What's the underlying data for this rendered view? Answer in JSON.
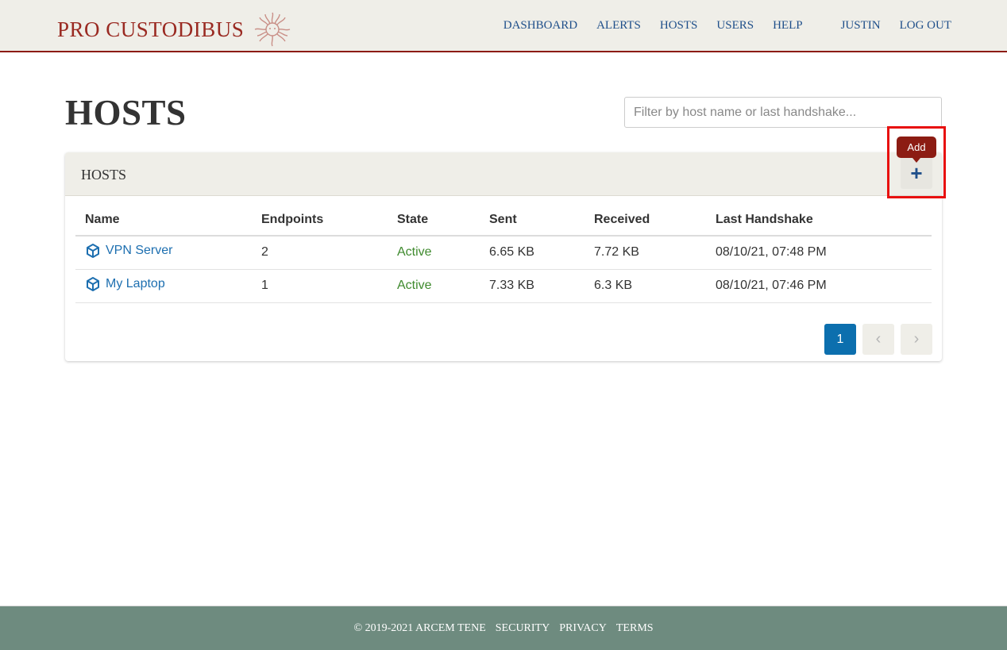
{
  "header": {
    "brand": "PRO CUSTODIBUS",
    "logo_icon": "medusa-logo-icon",
    "nav": {
      "dashboard": "DASHBOARD",
      "alerts": "ALERTS",
      "hosts": "HOSTS",
      "users": "USERS",
      "help": "HELP",
      "user": "JUSTIN",
      "logout": "LOG OUT"
    }
  },
  "page": {
    "title": "HOSTS",
    "filter_placeholder": "Filter by host name or last handshake...",
    "filter_value": ""
  },
  "card": {
    "title": "HOSTS",
    "add_icon": "plus-icon",
    "add_tooltip": "Add",
    "columns": [
      "Name",
      "Endpoints",
      "State",
      "Sent",
      "Received",
      "Last Handshake"
    ],
    "rows": [
      {
        "icon": "cube-icon",
        "name": "VPN Server",
        "endpoints": "2",
        "state": "Active",
        "sent": "6.65 KB",
        "received": "7.72 KB",
        "handshake": "08/10/21, 07:48 PM"
      },
      {
        "icon": "cube-icon",
        "name": "My Laptop",
        "endpoints": "1",
        "state": "Active",
        "sent": "7.33 KB",
        "received": "6.3 KB",
        "handshake": "08/10/21, 07:46 PM"
      }
    ],
    "pagination": {
      "current": "1",
      "prev_icon": "chevron-left-icon",
      "next_icon": "chevron-right-icon"
    }
  },
  "footer": {
    "copyright": "© 2019-2021 ARCEM TENE",
    "security": "SECURITY",
    "privacy": "PRIVACY",
    "terms": "TERMS"
  },
  "colors": {
    "brand": "#9a2a22",
    "header_bg": "#efeee8",
    "nav_link": "#1f4f8a",
    "active_state": "#3f8a2e",
    "page_current": "#0c6fae",
    "footer_bg": "#6e8b7f",
    "highlight": "#e8100f"
  }
}
